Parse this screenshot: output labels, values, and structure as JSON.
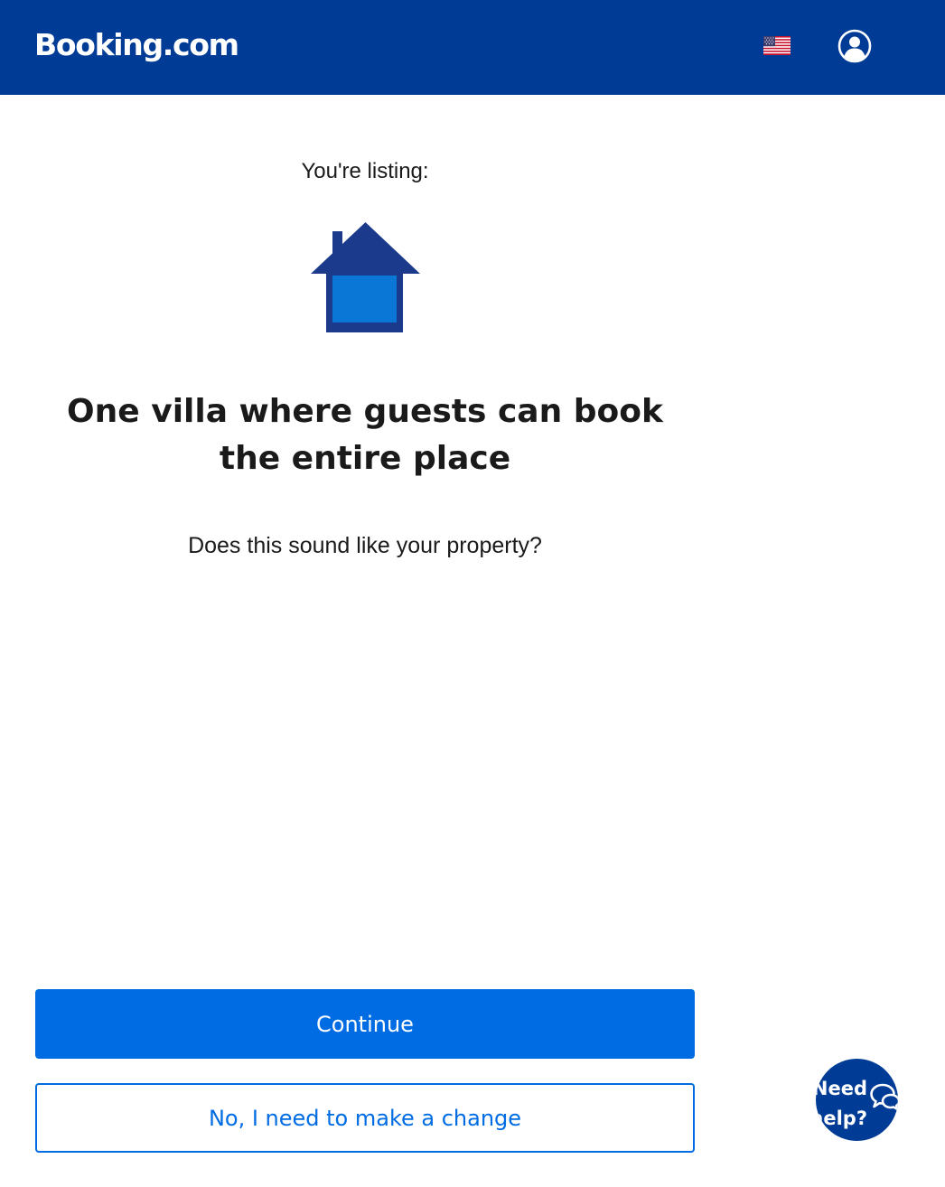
{
  "header": {
    "logo": "Booking.com",
    "flag_icon": "us-flag-icon",
    "profile_icon": "user-circle-icon",
    "background_color": "#003b95"
  },
  "main": {
    "listing_label": "You're listing:",
    "property_icon": "house-icon",
    "property_title": "One villa where guests can book the entire place",
    "question": "Does this sound like your property?"
  },
  "actions": {
    "continue_label": "Continue",
    "change_label": "No, I need to make a change",
    "primary_color": "#006ce4"
  },
  "help": {
    "line1": "Need",
    "line2": "help?",
    "icon": "chat-bubbles-icon"
  }
}
